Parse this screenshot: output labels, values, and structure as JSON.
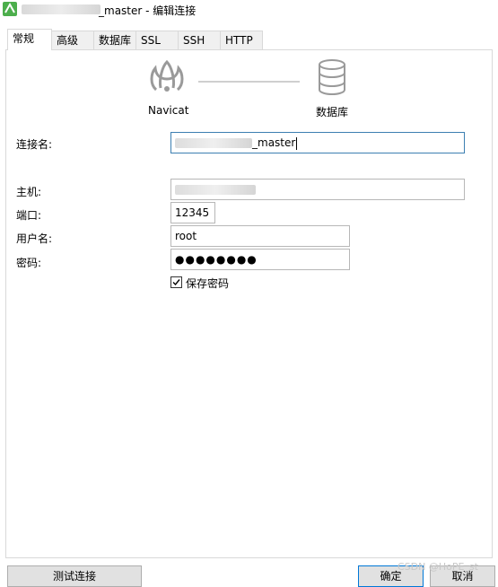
{
  "window": {
    "title_suffix": "_master - 编辑连接"
  },
  "tabs": [
    {
      "label": "常规",
      "active": true
    },
    {
      "label": "高级",
      "active": false
    },
    {
      "label": "数据库",
      "active": false
    },
    {
      "label": "SSL",
      "active": false
    },
    {
      "label": "SSH",
      "active": false
    },
    {
      "label": "HTTP",
      "active": false
    }
  ],
  "header": {
    "left_caption": "Navicat",
    "right_caption": "数据库"
  },
  "form": {
    "connection_name_label": "连接名:",
    "connection_name_suffix": "_master",
    "host_label": "主机:",
    "port_label": "端口:",
    "port_value": "12345",
    "username_label": "用户名:",
    "username_value": "root",
    "password_label": "密码:",
    "password_value": "●●●●●●●●",
    "save_password_label": "保存密码",
    "save_password_checked": true
  },
  "footer": {
    "test_button": "测试连接",
    "ok_button": "确定",
    "cancel_button": "取消"
  },
  "watermark": "CSDN @HoPE_st",
  "colors": {
    "focus_border": "#3c7fb1",
    "primary_border": "#0078d7",
    "app_icon_green": "#4cae4c"
  }
}
